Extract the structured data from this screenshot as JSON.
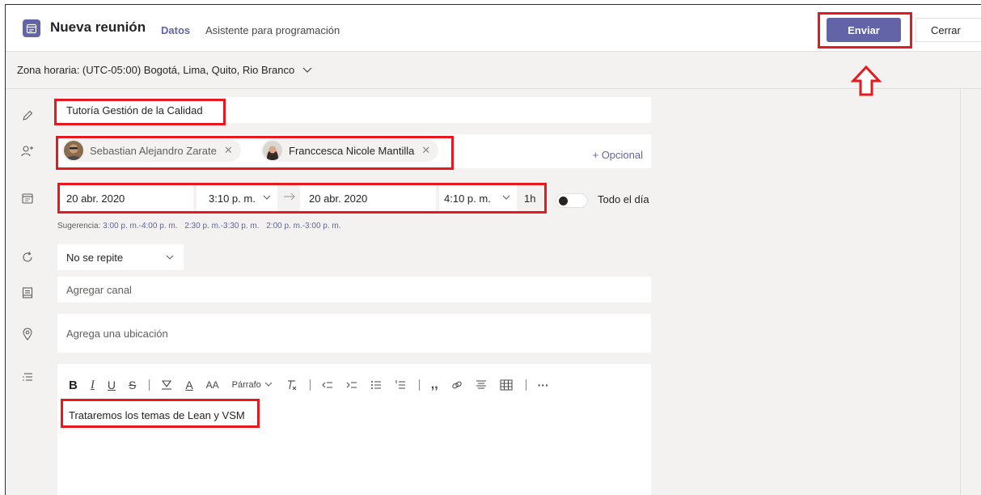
{
  "header": {
    "title": "Nueva reunión",
    "tabs": [
      {
        "label": "Datos",
        "active": true
      },
      {
        "label": "Asistente para programación",
        "active": false
      }
    ],
    "send_label": "Enviar",
    "close_label": "Cerrar"
  },
  "timezone": {
    "label": "Zona horaria: (UTC-05:00) Bogotá, Lima, Quito, Rio Branco"
  },
  "meeting": {
    "title_value": "Tutoría Gestión de la Calidad",
    "attendees": [
      {
        "name": "Sebastian Alejandro Zarate"
      },
      {
        "name": "Franccesca Nicole Mantilla"
      }
    ],
    "optional_label": "+ Opcional",
    "start_date": "20 abr. 2020",
    "start_time": "3:10 p. m.",
    "end_date": "20 abr. 2020",
    "end_time": "4:10 p. m.",
    "duration": "1h",
    "all_day_label": "Todo el día",
    "suggestion_label": "Sugerencia:",
    "suggestions": [
      "3:00 p. m.-4:00 p. m.",
      "2:30 p. m.-3:30 p. m.",
      "2:00 p. m.-3:00 p. m."
    ],
    "repeat_value": "No se repite",
    "channel_placeholder": "Agregar canal",
    "location_placeholder": "Agrega una ubicación",
    "body_text": "Trataremos los temas de Lean y VSM"
  },
  "toolbar": {
    "bold": "B",
    "italic": "I",
    "underline": "U",
    "strike": "S",
    "font_color": "A",
    "font_size": "AA",
    "paragraph": "Párrafo",
    "more": "···"
  },
  "colors": {
    "accent": "#6264a7",
    "annotation": "#e8181e"
  }
}
